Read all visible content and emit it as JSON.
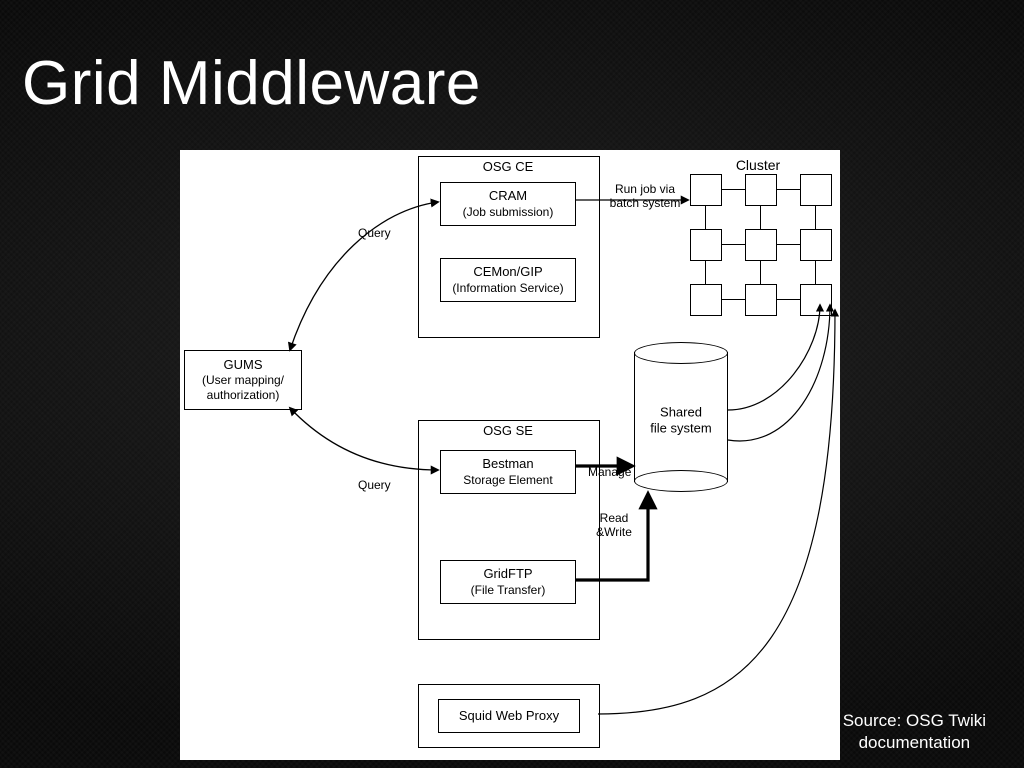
{
  "title": "Grid Middleware",
  "source_line1": "Source: OSG Twiki",
  "source_line2": "documentation",
  "containers": {
    "osg_ce": "OSG CE",
    "osg_se": "OSG SE"
  },
  "boxes": {
    "cram_t": "CRAM",
    "cram_s": "(Job submission)",
    "cemon_t": "CEMon/GIP",
    "cemon_s": "(Information Service)",
    "gums_t": "GUMS",
    "gums_s1": "(User mapping/",
    "gums_s2": "authorization)",
    "bestman_t": "Bestman",
    "bestman_s": "Storage Element",
    "gridftp_t": "GridFTP",
    "gridftp_s": "(File Transfer)",
    "squid": "Squid Web Proxy"
  },
  "labels": {
    "query1": "Query",
    "query2": "Query",
    "runjob_l1": "Run job via",
    "runjob_l2": "batch system",
    "manage": "Manage",
    "readwrite_l1": "Read",
    "readwrite_l2": "&Write",
    "shared_l1": "Shared",
    "shared_l2": "file system",
    "cluster": "Cluster"
  }
}
